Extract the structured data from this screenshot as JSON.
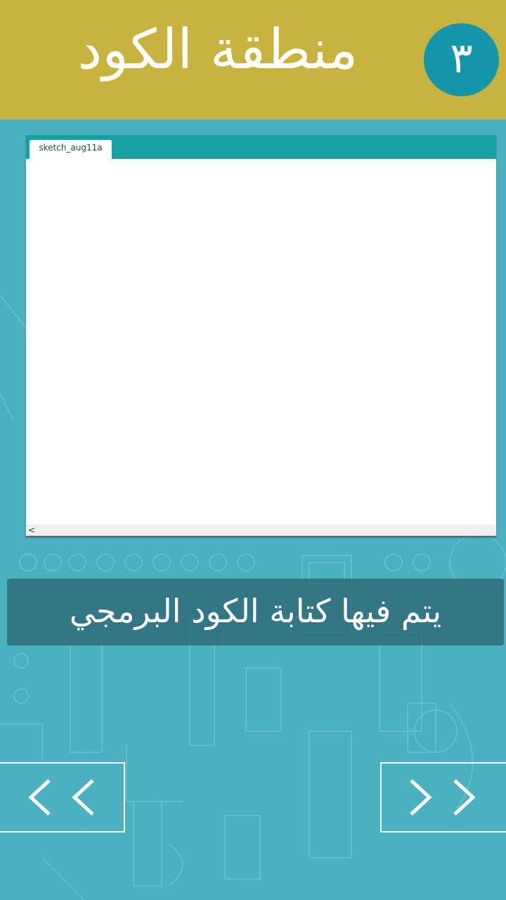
{
  "header": {
    "title": "منطقة الكود",
    "step_number": "٣"
  },
  "editor": {
    "tab_label": "sketch_aug11a",
    "scroll_left_glyph": "<"
  },
  "caption": {
    "text": "يتم فيها كتابة الكود البرمجي"
  },
  "nav": {
    "prev_icon": "double-chevron-left-icon",
    "next_icon": "double-chevron-right-icon"
  },
  "colors": {
    "background": "#4bb0c0",
    "header": "#c8b33e",
    "badge": "#1497a8",
    "editor_tabbar": "#17a1a5",
    "caption_bg": "#2b6471"
  }
}
